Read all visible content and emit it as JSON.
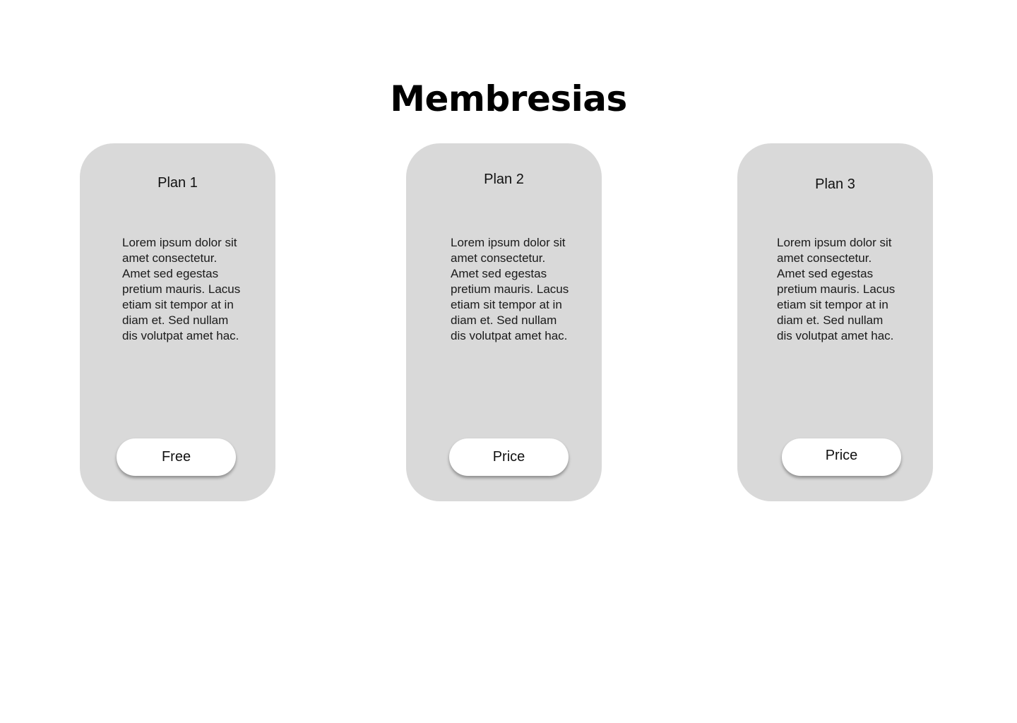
{
  "page": {
    "title": "Membresias"
  },
  "plans": [
    {
      "title": "Plan 1",
      "description": "Lorem ipsum dolor sit amet consectetur. Amet sed egestas pretium mauris. Lacus etiam sit tempor at in diam et. Sed nullam dis volutpat amet hac.",
      "button_label": "Free"
    },
    {
      "title": "Plan 2",
      "description": "Lorem ipsum dolor sit amet consectetur. Amet sed egestas pretium mauris. Lacus etiam sit tempor at in diam et. Sed nullam dis volutpat amet hac.",
      "button_label": "Price"
    },
    {
      "title": "Plan 3",
      "description": "Lorem ipsum dolor sit amet consectetur. Amet sed egestas pretium mauris. Lacus etiam sit tempor at in diam et. Sed nullam dis volutpat amet hac.",
      "button_label": "Price"
    }
  ],
  "colors": {
    "background": "#ffffff",
    "card": "#d9d9d9",
    "button": "#ffffff",
    "text": "#000000"
  }
}
